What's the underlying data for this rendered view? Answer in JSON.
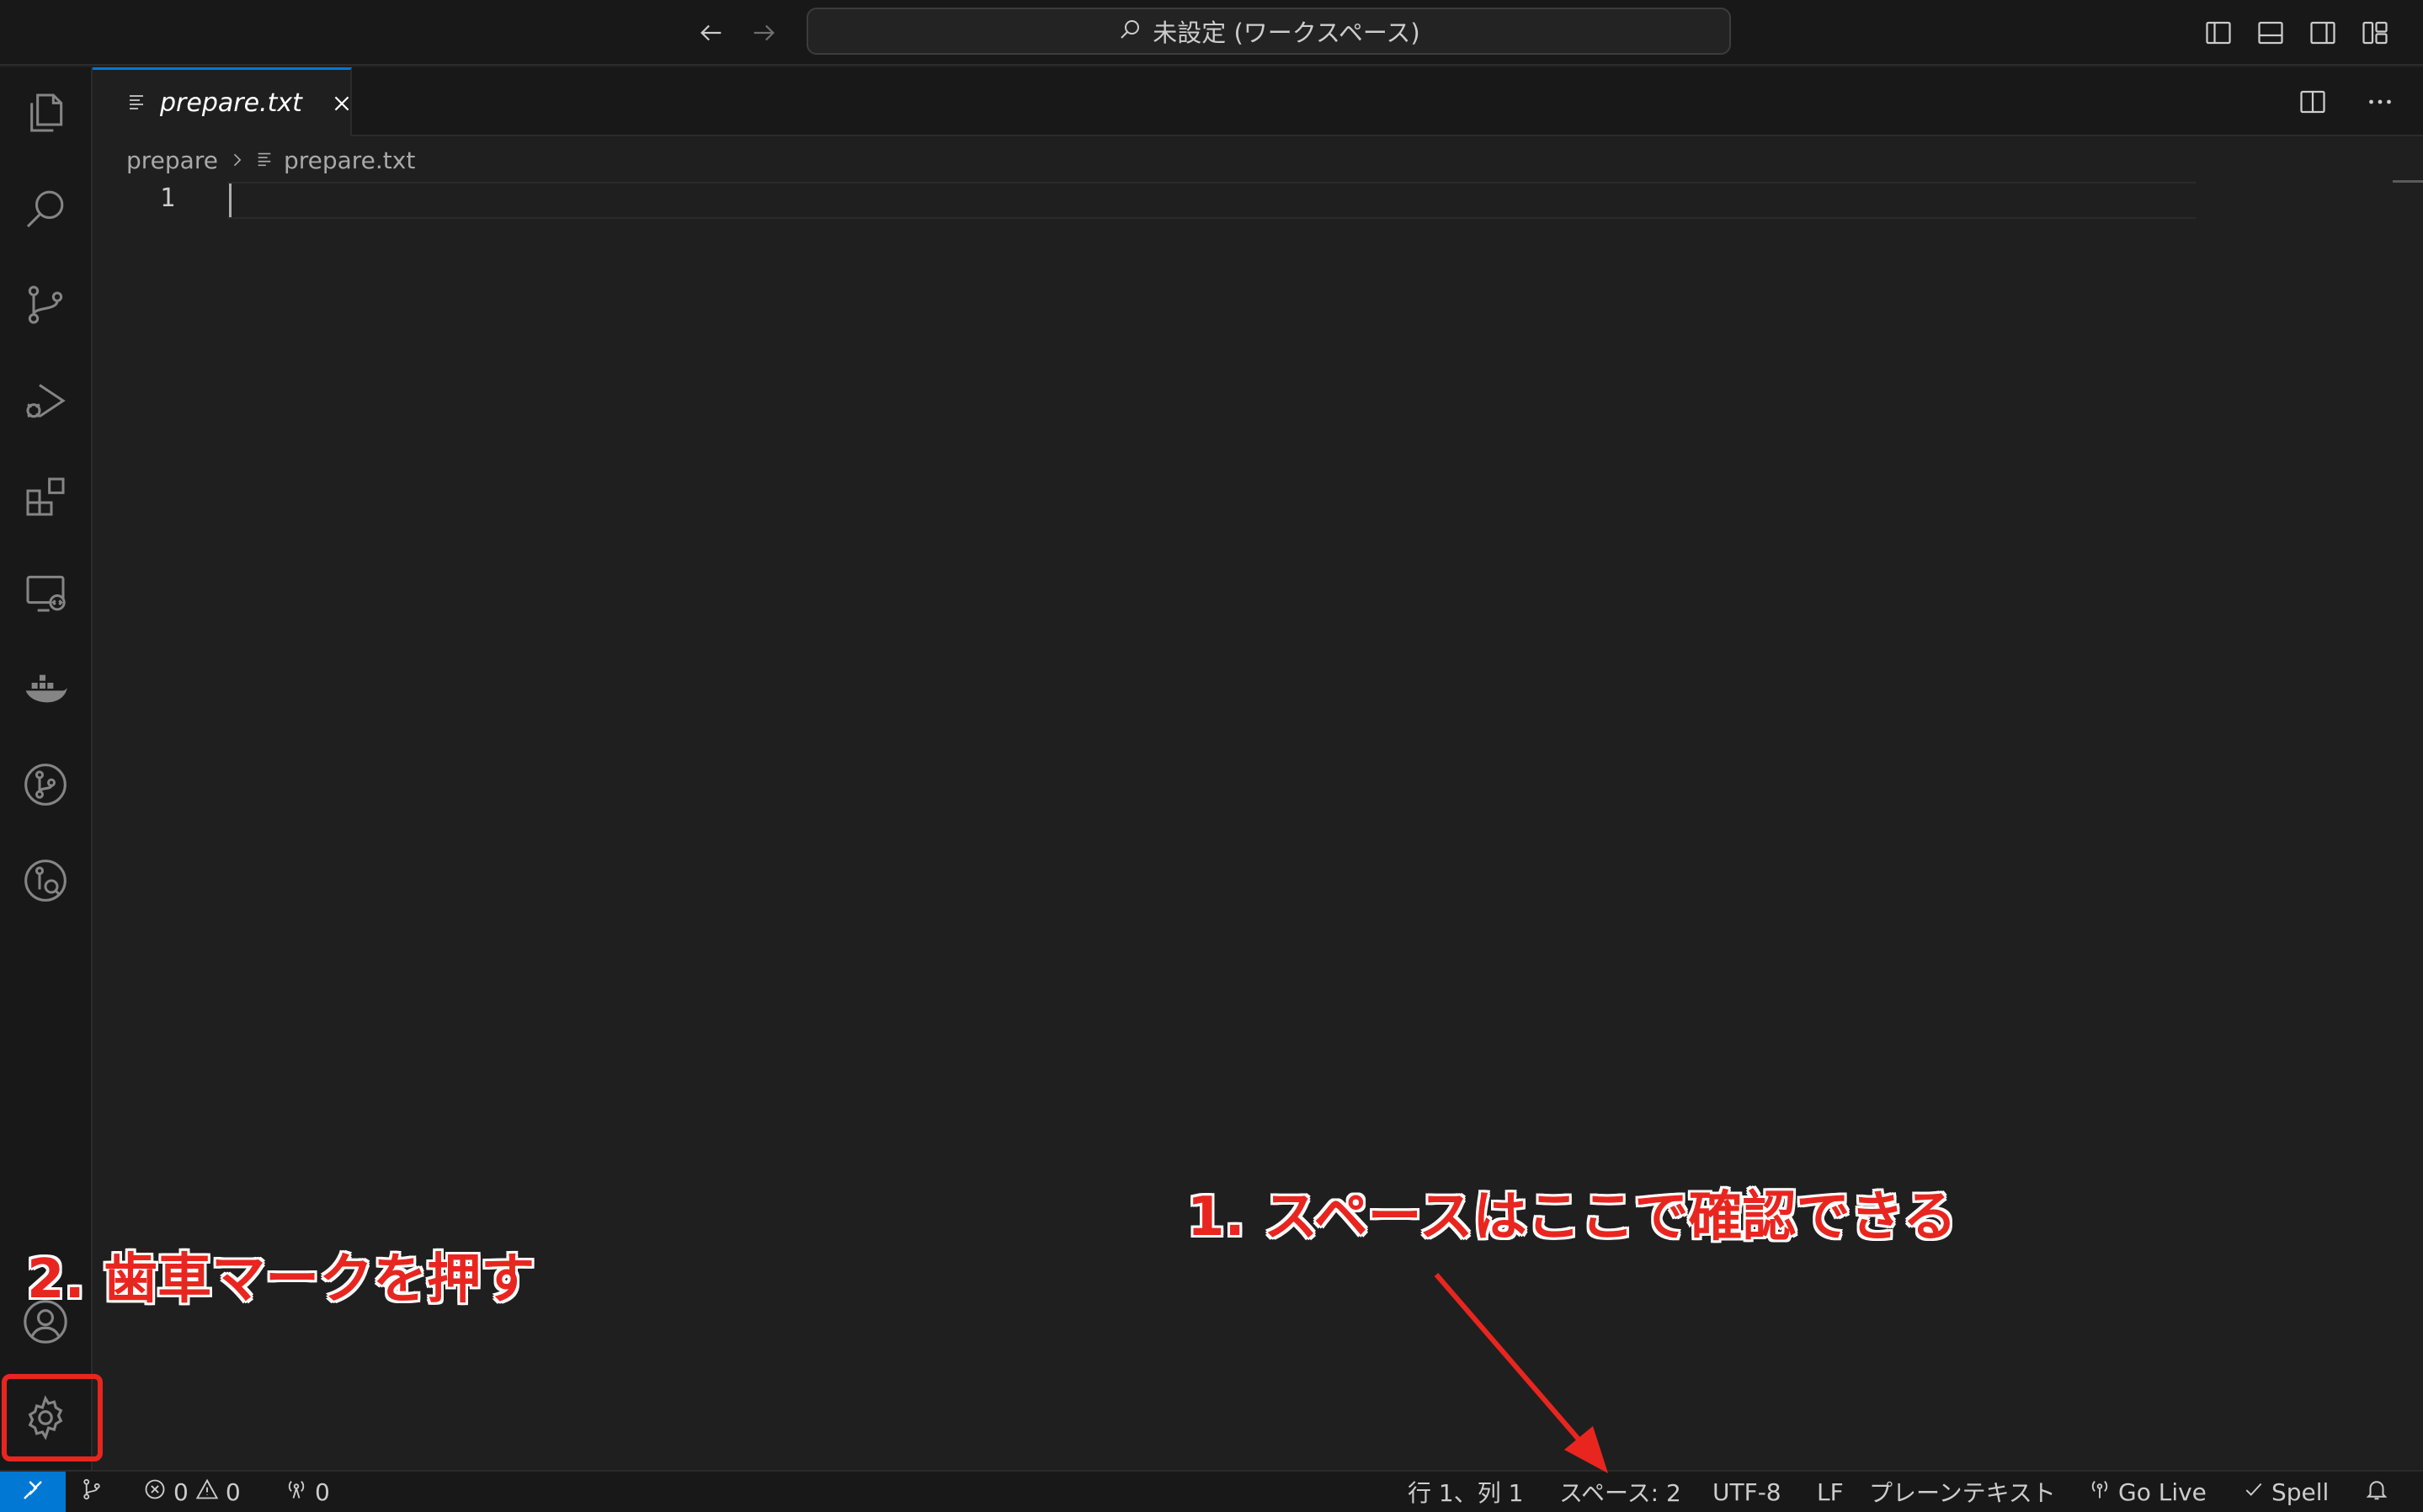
{
  "titlebar": {
    "command_center_text": "未設定 (ワークスペース)",
    "icons": [
      "arrow-left-icon",
      "arrow-right-icon",
      "search-icon",
      "toggle-primary-sidebar-icon",
      "toggle-panel-icon",
      "toggle-secondary-sidebar-icon",
      "customize-layout-icon"
    ]
  },
  "activity_bar": {
    "items": [
      "files-icon",
      "search-icon",
      "source-control-icon",
      "run-debug-icon",
      "extensions-icon",
      "remote-explorer-icon",
      "docker-icon",
      "git-graph-icon",
      "gitlens-icon"
    ],
    "bottom": [
      "account-icon",
      "gear-icon"
    ]
  },
  "tabs": [
    {
      "label": "prepare.txt",
      "icon": "text-file-icon",
      "active": true
    }
  ],
  "breadcrumb": {
    "folder": "prepare",
    "file": "prepare.txt"
  },
  "editor": {
    "line_numbers": [
      "1"
    ]
  },
  "statusbar": {
    "errors": "0",
    "warnings": "0",
    "ports": "0",
    "cursor_position": "行 1、列 1",
    "indentation": "スペース: 2",
    "encoding": "UTF-8",
    "eol": "LF",
    "language": "プレーンテキスト",
    "go_live": "Go Live",
    "spell": "Spell"
  },
  "annotations": {
    "step1": "1. スペースはここで確認できる",
    "step2": "2. 歯車マークを押す",
    "color": "#e8261f"
  },
  "colors": {
    "accent": "#0078d4",
    "background": "#1f1f1f",
    "chrome": "#181818"
  }
}
